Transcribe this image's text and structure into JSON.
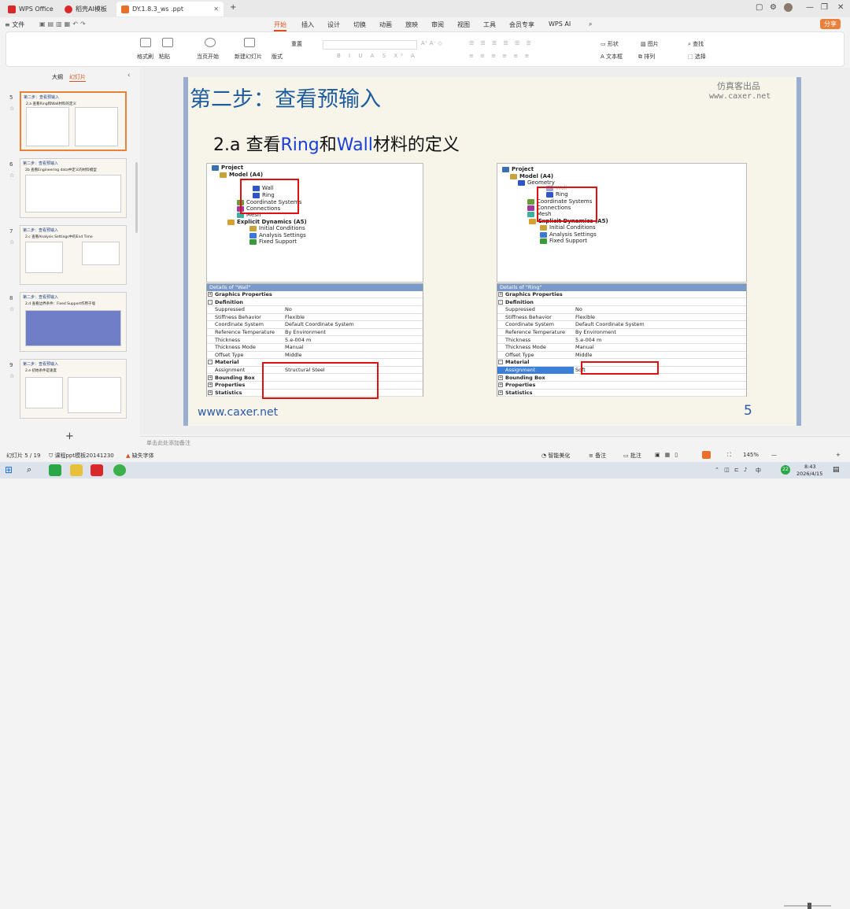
{
  "titlebar": {
    "tabs": [
      {
        "label": "WPS Office",
        "color": "#d8282a"
      },
      {
        "label": "稻壳AI模板",
        "color": "#d8282a"
      },
      {
        "label": "DY.1.8.3_ws .ppt",
        "color": "#e8702a"
      }
    ]
  },
  "menubar": {
    "file": "文件",
    "items": [
      "开始",
      "插入",
      "设计",
      "切换",
      "动画",
      "放映",
      "审阅",
      "视图",
      "工具",
      "会员专享",
      "WPS AI"
    ],
    "share": "分享"
  },
  "ribbon": {
    "format_brush": "格式刷",
    "paste": "粘贴",
    "from_current": "当页开始",
    "new_slide": "新建幻灯片",
    "layout": "版式",
    "reset": "重置",
    "shape": "形状",
    "picture": "图片",
    "find": "查找",
    "textbox": "文本框",
    "arrange": "排列",
    "select": "选择"
  },
  "leftpanel": {
    "outline_tab": "大纲",
    "slides_tab": "幻灯片",
    "thumbs": [
      {
        "num": "5",
        "title": "第二步：查看预输入",
        "sub": "2.a 查看Ring和Wall材料的定义"
      },
      {
        "num": "6",
        "title": "第二步：查看预输入",
        "sub": "2b 查看Engineering data中定义的材料模型"
      },
      {
        "num": "7",
        "title": "第二步：查看预输入",
        "sub": "2.c 查看Analysis Settings中的End Time"
      },
      {
        "num": "8",
        "title": "第二步：查看预输入",
        "sub": "2.d 查看边界条件：Fixed Support作用于墙"
      },
      {
        "num": "9",
        "title": "第二步：查看预输入",
        "sub": "2.e 初始条件是速度"
      }
    ],
    "add": "+"
  },
  "slide": {
    "title": "第二步：查看预输入",
    "watermark1": "仿真客出品",
    "watermark2": "www.caxer.net",
    "heading_prefix": "2.a  查看",
    "heading_ring": "Ring",
    "heading_and": "和",
    "heading_wall": "Wall",
    "heading_suffix": "材料的定义",
    "footer_url": "www.caxer.net",
    "page_num": "5",
    "left_tree": [
      "Project",
      "Model (A4)",
      "Wall",
      "Ring",
      "Coordinate Systems",
      "Connections",
      "Mesh",
      "Explicit Dynamics (A5)",
      "Initial Conditions",
      "Analysis Settings",
      "Fixed Support"
    ],
    "right_tree": [
      "Project",
      "Model (A4)",
      "Geometry",
      "Wall",
      "Ring",
      "Coordinate Systems",
      "Connections",
      "Mesh",
      "Explicit Dynamics (A5)",
      "Initial Conditions",
      "Analysis Settings",
      "Fixed Support"
    ],
    "left_details": {
      "header": "Details of \"Wall\"",
      "rows": [
        {
          "k": "Graphics Properties",
          "v": "",
          "sec": true,
          "pm": "+"
        },
        {
          "k": "Definition",
          "v": "",
          "sec": true,
          "pm": "-"
        },
        {
          "k": "Suppressed",
          "v": "No"
        },
        {
          "k": "Stiffness Behavior",
          "v": "Flexible"
        },
        {
          "k": "Coordinate System",
          "v": "Default Coordinate System"
        },
        {
          "k": "Reference Temperature",
          "v": "By Environment"
        },
        {
          "k": "Thickness",
          "v": "5.e-004 m"
        },
        {
          "k": "Thickness Mode",
          "v": "Manual"
        },
        {
          "k": "Offset Type",
          "v": "Middle"
        },
        {
          "k": "Material",
          "v": "",
          "sec": true,
          "pm": "-"
        },
        {
          "k": "Assignment",
          "v": "Structural Steel"
        },
        {
          "k": "Bounding Box",
          "v": "",
          "sec": true,
          "pm": "+"
        },
        {
          "k": "Properties",
          "v": "",
          "sec": true,
          "pm": "+"
        },
        {
          "k": "Statistics",
          "v": "",
          "sec": true,
          "pm": "+"
        }
      ]
    },
    "right_details": {
      "header": "Details of \"Ring\"",
      "rows": [
        {
          "k": "Graphics Properties",
          "v": "",
          "sec": true,
          "pm": "+"
        },
        {
          "k": "Definition",
          "v": "",
          "sec": true,
          "pm": "-"
        },
        {
          "k": "Suppressed",
          "v": "No"
        },
        {
          "k": "Stiffness Behavior",
          "v": "Flexible"
        },
        {
          "k": "Coordinate System",
          "v": "Default Coordinate System"
        },
        {
          "k": "Reference Temperature",
          "v": "By Environment"
        },
        {
          "k": "Thickness",
          "v": "5.e-004 m"
        },
        {
          "k": "Thickness Mode",
          "v": "Manual"
        },
        {
          "k": "Offset Type",
          "v": "Middle"
        },
        {
          "k": "Material",
          "v": "",
          "sec": true,
          "pm": "-"
        },
        {
          "k": "Assignment",
          "v": "Soft",
          "hl": true
        },
        {
          "k": "Bounding Box",
          "v": "",
          "sec": true,
          "pm": "+"
        },
        {
          "k": "Properties",
          "v": "",
          "sec": true,
          "pm": "+"
        },
        {
          "k": "Statistics",
          "v": "",
          "sec": true,
          "pm": "+"
        }
      ]
    }
  },
  "notes": {
    "placeholder": "单击此处添加备注"
  },
  "status": {
    "slide_count": "幻灯片 5 / 19",
    "template": "课程ppt模板20141230",
    "missing_font": "缺失字体",
    "smart_beautify": "智能美化",
    "notes": "备注",
    "comments": "批注",
    "zoom": "145%"
  },
  "taskbar": {
    "time": "8:43",
    "date": "2026/4/15",
    "lang": "中",
    "badge": "22"
  }
}
